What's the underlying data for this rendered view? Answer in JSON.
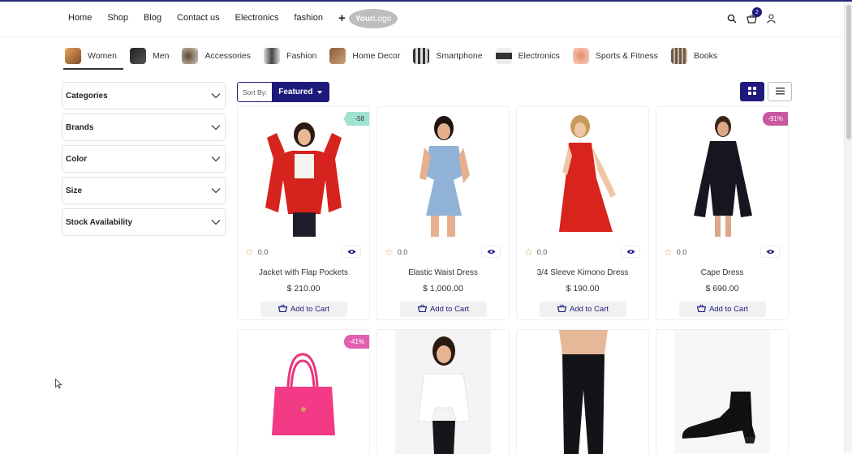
{
  "header": {
    "nav": [
      "Home",
      "Shop",
      "Blog",
      "Contact us",
      "Electronics",
      "fashion"
    ],
    "plus_glyph": "+",
    "logo_text_bold": "Your",
    "logo_text_thin": "Logo",
    "cart_count": "2"
  },
  "category_tabs": [
    {
      "label": "Women",
      "active": true
    },
    {
      "label": "Men",
      "active": false
    },
    {
      "label": "Accessories",
      "active": false
    },
    {
      "label": "Fashion",
      "active": false
    },
    {
      "label": "Home Decor",
      "active": false
    },
    {
      "label": "Smartphone",
      "active": false
    },
    {
      "label": "Electronics",
      "active": false
    },
    {
      "label": "Sports & Fitness",
      "active": false
    },
    {
      "label": "Books",
      "active": false
    }
  ],
  "filters": [
    "Categories",
    "Brands",
    "Color",
    "Size",
    "Stock Availability"
  ],
  "sort": {
    "label": "Sort By:",
    "value": "Featured"
  },
  "products": [
    {
      "name": "Jacket with Flap Pockets",
      "price": "$ 210.00",
      "rating": "0.0",
      "tag": "-58",
      "cart": "Add to Cart"
    },
    {
      "name": "Elastic Waist Dress",
      "price": "$ 1,000.00",
      "rating": "0.0",
      "tag": "",
      "cart": "Add to Cart"
    },
    {
      "name": "3/4 Sleeve Kimono Dress",
      "price": "$ 190.00",
      "rating": "0.0",
      "tag": "",
      "cart": "Add to Cart"
    },
    {
      "name": "Cape Dress",
      "price": "$ 690.00",
      "rating": "0.0",
      "tag": "-91%",
      "cart": "Add to Cart"
    },
    {
      "name": "",
      "price": "",
      "rating": "",
      "tag": "-41%",
      "cart": ""
    },
    {
      "name": "",
      "price": "",
      "rating": "",
      "tag": "",
      "cart": ""
    },
    {
      "name": "",
      "price": "",
      "rating": "",
      "tag": "",
      "cart": ""
    },
    {
      "name": "",
      "price": "",
      "rating": "",
      "tag": "",
      "cart": ""
    }
  ],
  "colors": {
    "brand": "#1d1a7c",
    "star": "#d8a54b"
  }
}
